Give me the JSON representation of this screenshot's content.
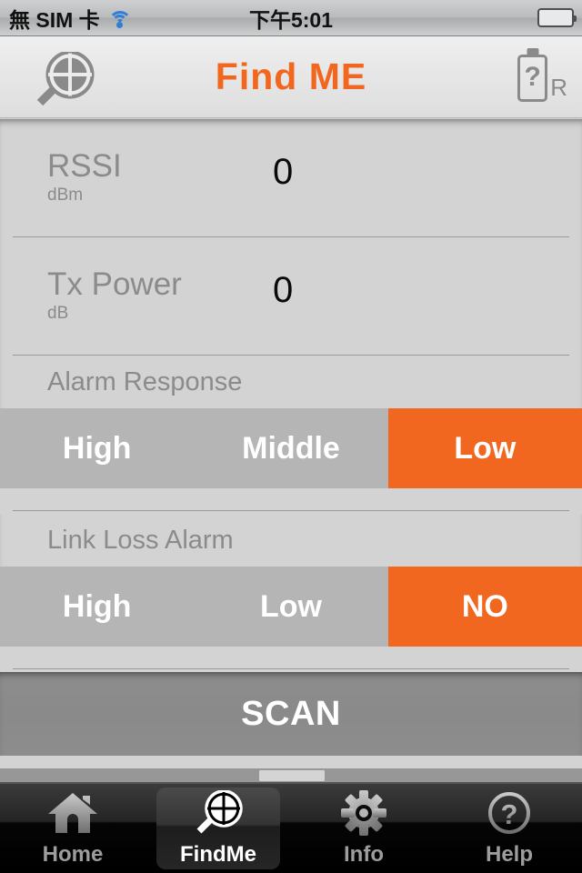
{
  "statusbar": {
    "carrier": "無 SIM 卡",
    "wifi_icon": "wifi-icon",
    "time": "下午5:01",
    "battery_icon": "battery-full-icon"
  },
  "navbar": {
    "title": "Find ME",
    "left_icon": "scope-magnifier-icon",
    "right_battery_text": "?",
    "right_battery_suffix": "R",
    "accent_color": "#f2671f"
  },
  "main": {
    "rows": [
      {
        "label": "RSSI",
        "unit": "dBm",
        "value": "0"
      },
      {
        "label": "Tx Power",
        "unit": "dB",
        "value": "0"
      }
    ],
    "sections": [
      {
        "label": "Alarm Response",
        "options": [
          "High",
          "Middle",
          "Low"
        ],
        "selected": "Low"
      },
      {
        "label": "Link Loss Alarm",
        "options": [
          "High",
          "Low",
          "NO"
        ],
        "selected": "NO"
      }
    ],
    "scan_label": "SCAN"
  },
  "tabbar": {
    "tabs": [
      {
        "label": "Home",
        "icon": "home-icon",
        "active": false
      },
      {
        "label": "FindMe",
        "icon": "scope-magnifier-icon",
        "active": true
      },
      {
        "label": "Info",
        "icon": "gear-icon",
        "active": false
      },
      {
        "label": "Help",
        "icon": "question-circle-icon",
        "active": false
      }
    ]
  }
}
